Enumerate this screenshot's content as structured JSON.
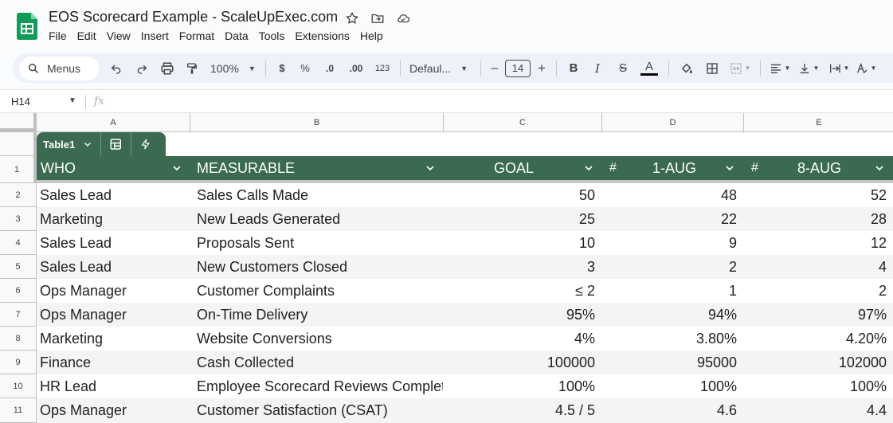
{
  "app": {
    "title": "EOS Scorecard Example - ScaleUpExec.com",
    "brand_color": "#0f9d58",
    "menu": [
      "File",
      "Edit",
      "View",
      "Insert",
      "Format",
      "Data",
      "Tools",
      "Extensions",
      "Help"
    ]
  },
  "toolbar": {
    "search_label": "Menus",
    "zoom": "100%",
    "currency": "$",
    "percent": "%",
    "dec_decrease": ".0",
    "dec_increase": ".00",
    "number_format": "123",
    "font": "Defaul...",
    "font_size": "14",
    "minus": "–",
    "plus": "+",
    "bold": "B",
    "italic": "I",
    "strike": "S",
    "text_color": "A"
  },
  "formula_bar": {
    "cell_ref": "H14",
    "fx": "fx"
  },
  "columns": [
    "A",
    "B",
    "C",
    "D",
    "E"
  ],
  "rows": [
    "1",
    "2",
    "3",
    "4",
    "5",
    "6",
    "7",
    "8",
    "9",
    "10",
    "11"
  ],
  "table": {
    "name": "Table1",
    "header_color": "#3a6a4f",
    "headers": {
      "who": "WHO",
      "measurable": "MEASURABLE",
      "goal": "GOAL",
      "hash1": "#",
      "week1": "1-AUG",
      "hash2": "#",
      "week2": "8-AUG"
    },
    "data": [
      {
        "who": "Sales Lead",
        "measurable": "Sales Calls Made",
        "goal": "50",
        "week1": "48",
        "week2": "52"
      },
      {
        "who": "Marketing",
        "measurable": "New Leads Generated",
        "goal": "25",
        "week1": "22",
        "week2": "28"
      },
      {
        "who": "Sales Lead",
        "measurable": "Proposals Sent",
        "goal": "10",
        "week1": "9",
        "week2": "12"
      },
      {
        "who": "Sales Lead",
        "measurable": "New Customers Closed",
        "goal": "3",
        "week1": "2",
        "week2": "4"
      },
      {
        "who": "Ops Manager",
        "measurable": "Customer Complaints",
        "goal": "≤ 2",
        "week1": "1",
        "week2": "2"
      },
      {
        "who": "Ops Manager",
        "measurable": "On-Time Delivery",
        "goal": "95%",
        "week1": "94%",
        "week2": "97%"
      },
      {
        "who": "Marketing",
        "measurable": "Website Conversions",
        "goal": "4%",
        "week1": "3.80%",
        "week2": "4.20%"
      },
      {
        "who": "Finance",
        "measurable": "Cash Collected",
        "goal": "100000",
        "week1": "95000",
        "week2": "102000"
      },
      {
        "who": "HR Lead",
        "measurable": "Employee Scorecard Reviews Completed",
        "goal": "100%",
        "week1": "100%",
        "week2": "100%"
      },
      {
        "who": "Ops Manager",
        "measurable": "Customer Satisfaction (CSAT)",
        "goal": "4.5 / 5",
        "week1": "4.6",
        "week2": "4.4"
      }
    ]
  }
}
